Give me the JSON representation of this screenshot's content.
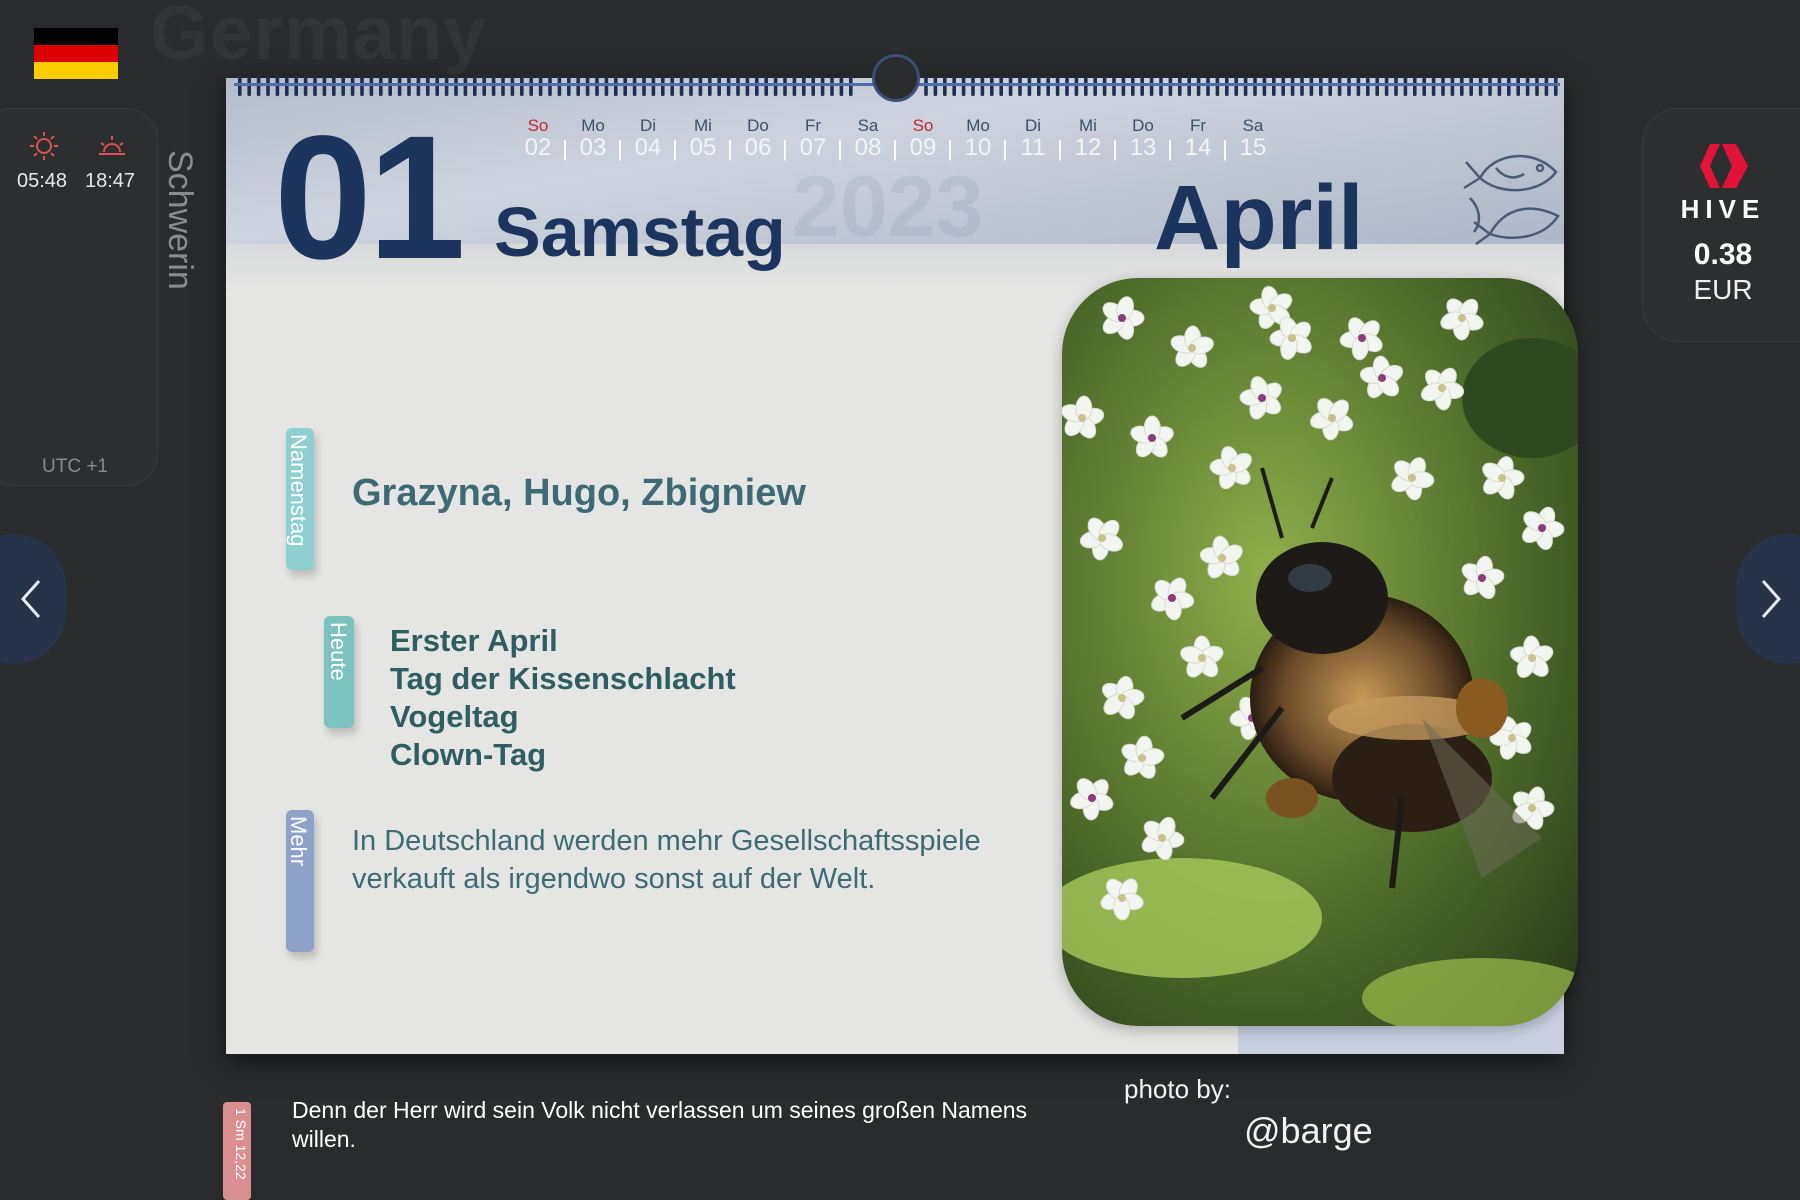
{
  "header": {
    "country": "Germany",
    "city": "Schwerin"
  },
  "sun": {
    "sunrise": "05:48",
    "sunset": "18:47",
    "utc": "UTC +1",
    "sunrise_icon": "sunrise-icon",
    "sunset_icon": "sunset-icon"
  },
  "calendar": {
    "day_number": "01",
    "weekday": "Samstag",
    "month": "April",
    "year": "2023",
    "strip": [
      {
        "day": "So",
        "num": "02",
        "sunday": true
      },
      {
        "day": "Mo",
        "num": "03",
        "sunday": false
      },
      {
        "day": "Di",
        "num": "04",
        "sunday": false
      },
      {
        "day": "Mi",
        "num": "05",
        "sunday": false
      },
      {
        "day": "Do",
        "num": "06",
        "sunday": false
      },
      {
        "day": "Fr",
        "num": "07",
        "sunday": false
      },
      {
        "day": "Sa",
        "num": "08",
        "sunday": false
      },
      {
        "day": "So",
        "num": "09",
        "sunday": true
      },
      {
        "day": "Mo",
        "num": "10",
        "sunday": false
      },
      {
        "day": "Di",
        "num": "11",
        "sunday": false
      },
      {
        "day": "Mi",
        "num": "12",
        "sunday": false
      },
      {
        "day": "Do",
        "num": "13",
        "sunday": false
      },
      {
        "day": "Fr",
        "num": "14",
        "sunday": false
      },
      {
        "day": "Sa",
        "num": "15",
        "sunday": false
      }
    ],
    "zodiac_icon": "pisces-icon"
  },
  "tabs": {
    "namenstag": "Namenstag",
    "heute": "Heute",
    "mehr": "Mehr"
  },
  "names": "Grazyna, Hugo, Zbigniew",
  "today": {
    "line1": "Erster April",
    "line2": "Tag der Kissenschlacht",
    "line3": "Vogeltag",
    "line4": "Clown-Tag"
  },
  "fact": "In Deutschland werden mehr Gesellschaftsspiele verkauft als irgendwo sonst auf der Welt.",
  "verse": {
    "ref": "1 Sm 12,22",
    "text": "Denn der Herr wird sein Volk nicht verlassen um seines großen Namens willen."
  },
  "photo": {
    "by_label": "photo by:",
    "author": "@barge"
  },
  "hive": {
    "name": "HIVE",
    "price": "0.38",
    "currency": "EUR",
    "logo_icon": "hive-logo-icon"
  },
  "nav": {
    "prev_icon": "chevron-left-icon",
    "next_icon": "chevron-right-icon"
  },
  "colors": {
    "navy": "#1c355e",
    "teal": "#3d6b75",
    "sunday": "#c62828",
    "hive_red": "#e31337",
    "background": "#2a2b2d"
  }
}
